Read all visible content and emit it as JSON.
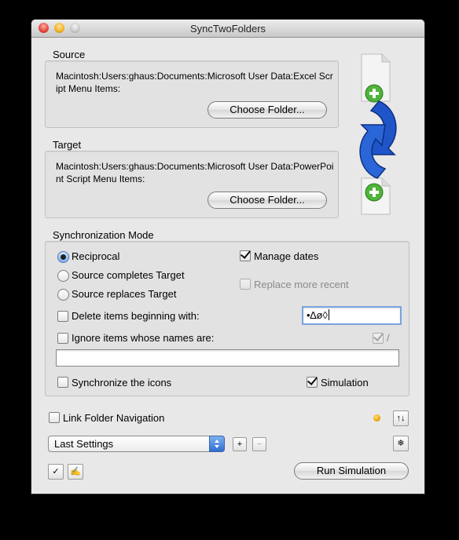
{
  "window": {
    "title": "SyncTwoFolders"
  },
  "source": {
    "label": "Source",
    "path": "Macintosh:Users:ghaus:Documents:Microsoft User Data:Excel Script Menu Items:",
    "choose_button": "Choose Folder..."
  },
  "target": {
    "label": "Target",
    "path": "Macintosh:Users:ghaus:Documents:Microsoft User Data:PowerPoint Script Menu Items:",
    "choose_button": "Choose Folder..."
  },
  "sync_mode": {
    "label": "Synchronization Mode",
    "modes": [
      "Reciprocal",
      "Source completes Target",
      "Source replaces Target"
    ],
    "selected_mode": "Reciprocal",
    "manage_dates": {
      "label": "Manage dates",
      "checked": true
    },
    "replace_more_recent": {
      "label": "Replace more recent",
      "checked": false,
      "enabled": false
    },
    "delete_items": {
      "label": "Delete items beginning with:",
      "checked": false,
      "value": "•∆ø◊"
    },
    "ignore_items": {
      "label": "Ignore items whose names are:",
      "checked": false,
      "separator_checked": true,
      "separator": "/",
      "value": ""
    },
    "sync_icons": {
      "label": "Synchronize the icons",
      "checked": false
    },
    "simulation": {
      "label": "Simulation",
      "checked": true
    }
  },
  "bottom": {
    "link_folder_navigation": {
      "label": "Link Folder Navigation",
      "checked": false
    },
    "status_indicator_color": "#f0a400",
    "swap_button": "↑↓",
    "settings_popup": {
      "selected": "Last Settings"
    },
    "add_button": "+",
    "remove_button": "−",
    "settings_gear_icon": "gear-icon",
    "check_button": "✓",
    "edit_button": "✍",
    "run_button": "Run Simulation"
  },
  "colors": {
    "accent": "#2f6ed3",
    "sync_arrow": "#1f55c8",
    "plus_green": "#4fb43a"
  }
}
